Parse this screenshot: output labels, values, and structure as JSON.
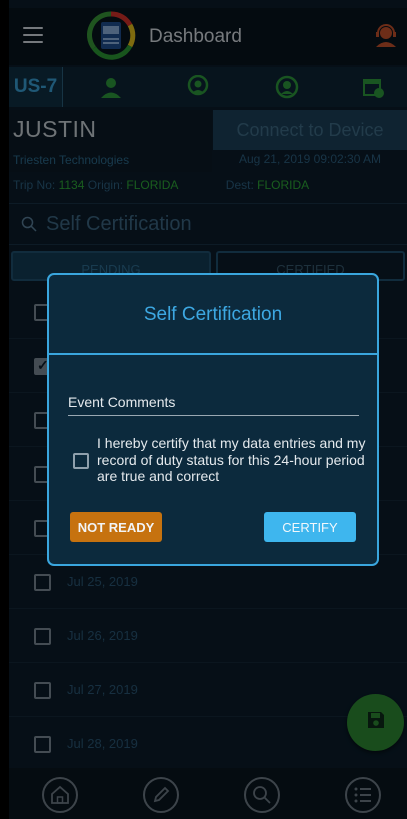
{
  "header": {
    "title": "Dashboard",
    "menu_icon": "hamburger-icon",
    "support_icon": "support-agent-icon"
  },
  "vehicle": {
    "id": "US-7",
    "icons": [
      "driver-icon",
      "co-driver-icon",
      "dispatch-icon",
      "calendar-icon"
    ]
  },
  "driver": {
    "name": "JUSTIN",
    "company": "Triesten Technologies",
    "connect_label": "Connect to Device",
    "datetime": "Aug 21, 2019 09:02:30 AM"
  },
  "trip": {
    "trip_label": "Trip No:",
    "trip_no": "1134",
    "origin_label": "Origin:",
    "origin": "FLORIDA",
    "dest_label": "Dest:",
    "dest": "FLORIDA"
  },
  "search": {
    "text": "Self Certification"
  },
  "tabs": {
    "pending": "PENDING",
    "certified": "CERTIFIED"
  },
  "list": {
    "rows": [
      {
        "date": "",
        "checked": false
      },
      {
        "date": "",
        "checked": true
      },
      {
        "date": "",
        "checked": false
      },
      {
        "date": "",
        "checked": false
      },
      {
        "date": "",
        "checked": false
      },
      {
        "date": "Jul 25, 2019",
        "checked": false
      },
      {
        "date": "Jul 26, 2019",
        "checked": false
      },
      {
        "date": "Jul 27, 2019",
        "checked": false
      },
      {
        "date": "Jul 28, 2019",
        "checked": false
      }
    ]
  },
  "dialog": {
    "title": "Self Certification",
    "event_comments_label": "Event Comments",
    "statement": "I hereby certify that my data entries and my record of duty status for this 24-hour period are true and correct",
    "not_ready_label": "NOT READY",
    "certify_label": "CERTIFY"
  },
  "bottom_nav": [
    "home-icon",
    "edit-icon",
    "search-icon",
    "list-icon"
  ],
  "colors": {
    "accent": "#3aa6de",
    "green": "#2faa38",
    "orange": "#c6720f",
    "background": "#0b1d2b"
  }
}
